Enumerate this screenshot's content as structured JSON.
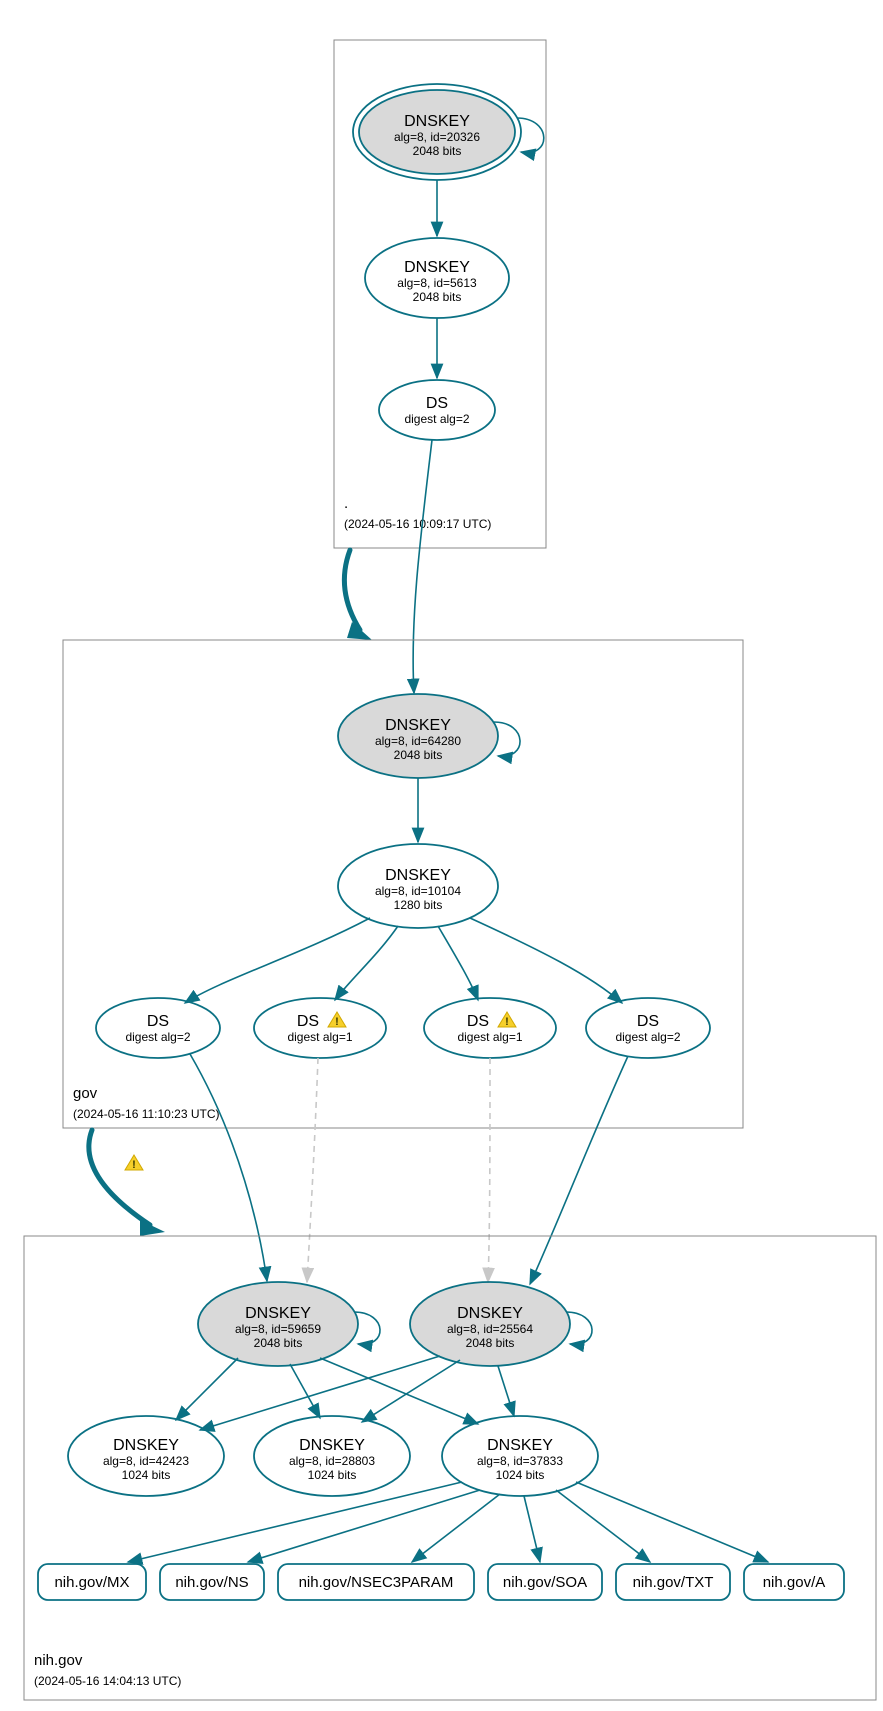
{
  "colors": {
    "primary": "#0b7184",
    "nodeFilled": "#d9d9d9",
    "warning": "#f6cf2a"
  },
  "zones": {
    "root": {
      "label": ".",
      "timestamp": "(2024-05-16 10:09:17 UTC)"
    },
    "gov": {
      "label": "gov",
      "timestamp": "(2024-05-16 11:10:23 UTC)"
    },
    "nih": {
      "label": "nih.gov",
      "timestamp": "(2024-05-16 14:04:13 UTC)"
    }
  },
  "nodes": {
    "root_ksk": {
      "title": "DNSKEY",
      "line2": "alg=8, id=20326",
      "line3": "2048 bits"
    },
    "root_zsk": {
      "title": "DNSKEY",
      "line2": "alg=8, id=5613",
      "line3": "2048 bits"
    },
    "root_ds": {
      "title": "DS",
      "line2": "digest alg=2"
    },
    "gov_ksk": {
      "title": "DNSKEY",
      "line2": "alg=8, id=64280",
      "line3": "2048 bits"
    },
    "gov_zsk": {
      "title": "DNSKEY",
      "line2": "alg=8, id=10104",
      "line3": "1280 bits"
    },
    "gov_ds1": {
      "title": "DS",
      "line2": "digest alg=2"
    },
    "gov_ds2": {
      "title": "DS",
      "line2": "digest alg=1"
    },
    "gov_ds3": {
      "title": "DS",
      "line2": "digest alg=1"
    },
    "gov_ds4": {
      "title": "DS",
      "line2": "digest alg=2"
    },
    "nih_ksk1": {
      "title": "DNSKEY",
      "line2": "alg=8, id=59659",
      "line3": "2048 bits"
    },
    "nih_ksk2": {
      "title": "DNSKEY",
      "line2": "alg=8, id=25564",
      "line3": "2048 bits"
    },
    "nih_zsk1": {
      "title": "DNSKEY",
      "line2": "alg=8, id=42423",
      "line3": "1024 bits"
    },
    "nih_zsk2": {
      "title": "DNSKEY",
      "line2": "alg=8, id=28803",
      "line3": "1024 bits"
    },
    "nih_zsk3": {
      "title": "DNSKEY",
      "line2": "alg=8, id=37833",
      "line3": "1024 bits"
    }
  },
  "rrsets": {
    "mx": "nih.gov/MX",
    "ns": "nih.gov/NS",
    "nsec3": "nih.gov/NSEC3PARAM",
    "soa": "nih.gov/SOA",
    "txt": "nih.gov/TXT",
    "a": "nih.gov/A"
  }
}
